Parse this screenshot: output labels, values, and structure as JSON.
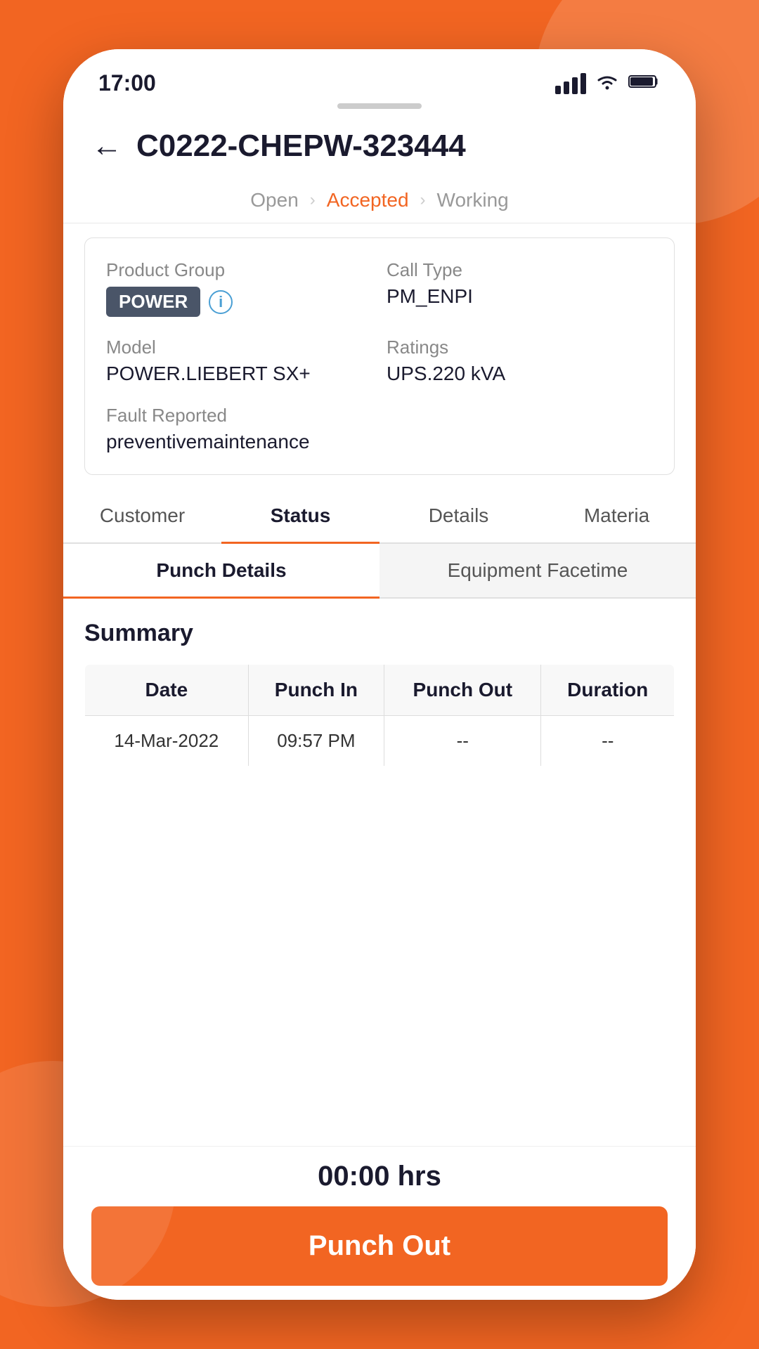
{
  "statusBar": {
    "time": "17:00"
  },
  "header": {
    "title": "C0222-CHEPW-323444",
    "backLabel": "←"
  },
  "progressSteps": {
    "steps": [
      {
        "label": "Open",
        "active": false
      },
      {
        "label": "Accepted",
        "active": true
      },
      {
        "label": "Working",
        "active": false
      }
    ]
  },
  "infoCard": {
    "productGroupLabel": "Product Group",
    "productGroupBadge": "POWER",
    "callTypeLabel": "Call Type",
    "callTypeValue": "PM_ENPI",
    "modelLabel": "Model",
    "modelValue": "POWER.LIEBERT SX+",
    "ratingsLabel": "Ratings",
    "ratingsValue": "UPS.220 kVA",
    "faultLabel": "Fault Reported",
    "faultValue": "preventivemaintenance"
  },
  "mainTabs": [
    {
      "label": "Customer",
      "active": false
    },
    {
      "label": "Status",
      "active": true
    },
    {
      "label": "Details",
      "active": false
    },
    {
      "label": "Materia",
      "active": false
    }
  ],
  "subTabs": [
    {
      "label": "Punch Details",
      "active": true
    },
    {
      "label": "Equipment Facetime",
      "active": false
    }
  ],
  "summary": {
    "title": "Summary",
    "tableHeaders": [
      "Date",
      "Punch In",
      "Punch Out",
      "Duration"
    ],
    "tableRows": [
      {
        "date": "14-Mar-2022",
        "punchIn": "09:57 PM",
        "punchOut": "--",
        "duration": "--"
      }
    ]
  },
  "bottom": {
    "totalHours": "00:00 hrs",
    "punchOutLabel": "Punch Out"
  },
  "punchInLabel": "Punch In",
  "durationLabel": "Duration"
}
